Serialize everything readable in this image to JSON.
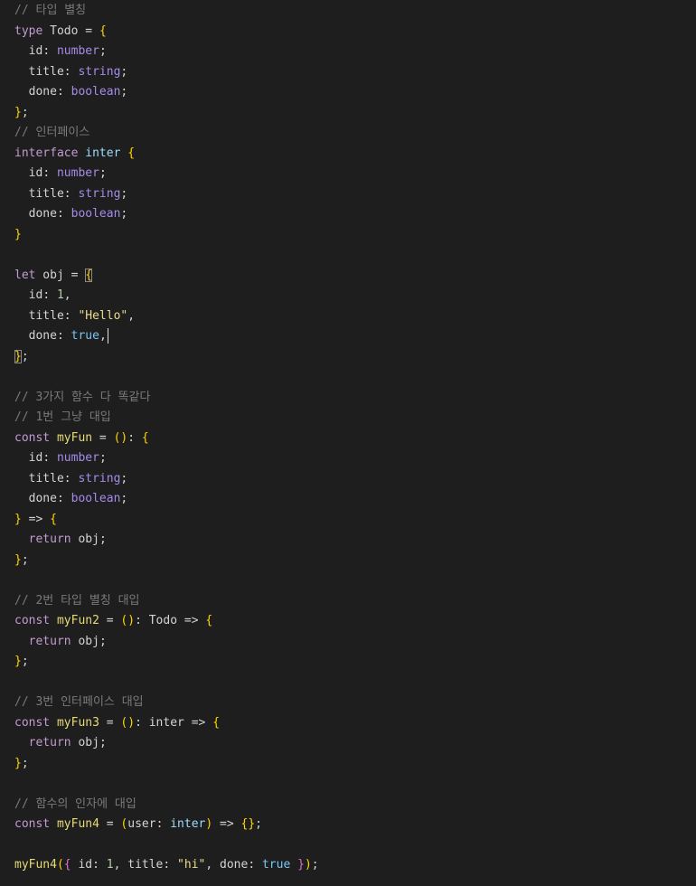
{
  "colors": {
    "background": "#1e1e1e",
    "comment": "#7a7a7a",
    "keyword": "#c39bd3",
    "brace": "#ffd700",
    "brace_nested": "#da70d6",
    "number": "#b5cea8",
    "string": "#ecdc8c",
    "bool": "#7ac6f5",
    "function_name": "#e6db74",
    "type_keyword": "#a58bea"
  },
  "lines": [
    [
      {
        "t": "comment",
        "v": "// 타입 별칭"
      }
    ],
    [
      {
        "t": "keyword",
        "v": "type"
      },
      {
        "t": "var",
        "v": " Todo "
      },
      {
        "t": "op",
        "v": "= "
      },
      {
        "t": "brace",
        "v": "{"
      }
    ],
    [
      {
        "t": "prop",
        "v": "  id"
      },
      {
        "t": "punct",
        "v": ": "
      },
      {
        "t": "typeword",
        "v": "number"
      },
      {
        "t": "punct",
        "v": ";"
      }
    ],
    [
      {
        "t": "prop",
        "v": "  title"
      },
      {
        "t": "punct",
        "v": ": "
      },
      {
        "t": "typeword",
        "v": "string"
      },
      {
        "t": "punct",
        "v": ";"
      }
    ],
    [
      {
        "t": "prop",
        "v": "  done"
      },
      {
        "t": "punct",
        "v": ": "
      },
      {
        "t": "typeword",
        "v": "boolean"
      },
      {
        "t": "punct",
        "v": ";"
      }
    ],
    [
      {
        "t": "brace",
        "v": "}"
      },
      {
        "t": "punct",
        "v": ";"
      }
    ],
    [
      {
        "t": "comment",
        "v": "// 인터페이스"
      }
    ],
    [
      {
        "t": "keyword",
        "v": "interface"
      },
      {
        "t": "var",
        "v": " "
      },
      {
        "t": "interface-name",
        "v": "inter"
      },
      {
        "t": "var",
        "v": " "
      },
      {
        "t": "brace",
        "v": "{"
      }
    ],
    [
      {
        "t": "prop",
        "v": "  id"
      },
      {
        "t": "punct",
        "v": ": "
      },
      {
        "t": "typeword",
        "v": "number"
      },
      {
        "t": "punct",
        "v": ";"
      }
    ],
    [
      {
        "t": "prop",
        "v": "  title"
      },
      {
        "t": "punct",
        "v": ": "
      },
      {
        "t": "typeword",
        "v": "string"
      },
      {
        "t": "punct",
        "v": ";"
      }
    ],
    [
      {
        "t": "prop",
        "v": "  done"
      },
      {
        "t": "punct",
        "v": ": "
      },
      {
        "t": "typeword",
        "v": "boolean"
      },
      {
        "t": "punct",
        "v": ";"
      }
    ],
    [
      {
        "t": "brace",
        "v": "}"
      }
    ],
    [],
    [
      {
        "t": "keyword",
        "v": "let"
      },
      {
        "t": "var",
        "v": " obj "
      },
      {
        "t": "op",
        "v": "= "
      },
      {
        "t": "brace",
        "v": "{",
        "match": true
      }
    ],
    [
      {
        "t": "prop",
        "v": "  id"
      },
      {
        "t": "punct",
        "v": ": "
      },
      {
        "t": "number",
        "v": "1"
      },
      {
        "t": "punct",
        "v": ","
      }
    ],
    [
      {
        "t": "prop",
        "v": "  title"
      },
      {
        "t": "punct",
        "v": ": "
      },
      {
        "t": "string",
        "v": "\"Hello\""
      },
      {
        "t": "punct",
        "v": ","
      }
    ],
    [
      {
        "t": "prop",
        "v": "  done"
      },
      {
        "t": "punct",
        "v": ": "
      },
      {
        "t": "bool",
        "v": "true"
      },
      {
        "t": "punct",
        "v": ","
      },
      {
        "t": "cursor",
        "v": ""
      }
    ],
    [
      {
        "t": "brace",
        "v": "}",
        "match": true
      },
      {
        "t": "punct",
        "v": ";"
      }
    ],
    [],
    [
      {
        "t": "comment",
        "v": "// 3가지 함수 다 똑같다"
      }
    ],
    [
      {
        "t": "comment",
        "v": "// 1번 그냥 대입"
      }
    ],
    [
      {
        "t": "keyword",
        "v": "const"
      },
      {
        "t": "var",
        "v": " "
      },
      {
        "t": "fn",
        "v": "myFun"
      },
      {
        "t": "op",
        "v": " = "
      },
      {
        "t": "brace",
        "v": "()"
      },
      {
        "t": "punct",
        "v": ": "
      },
      {
        "t": "brace",
        "v": "{"
      }
    ],
    [
      {
        "t": "prop",
        "v": "  id"
      },
      {
        "t": "punct",
        "v": ": "
      },
      {
        "t": "typeword",
        "v": "number"
      },
      {
        "t": "punct",
        "v": ";"
      }
    ],
    [
      {
        "t": "prop",
        "v": "  title"
      },
      {
        "t": "punct",
        "v": ": "
      },
      {
        "t": "typeword",
        "v": "string"
      },
      {
        "t": "punct",
        "v": ";"
      }
    ],
    [
      {
        "t": "prop",
        "v": "  done"
      },
      {
        "t": "punct",
        "v": ": "
      },
      {
        "t": "typeword",
        "v": "boolean"
      },
      {
        "t": "punct",
        "v": ";"
      }
    ],
    [
      {
        "t": "brace",
        "v": "}"
      },
      {
        "t": "op",
        "v": " => "
      },
      {
        "t": "brace",
        "v": "{"
      }
    ],
    [
      {
        "t": "keyword",
        "v": "  return"
      },
      {
        "t": "var",
        "v": " obj"
      },
      {
        "t": "punct",
        "v": ";"
      }
    ],
    [
      {
        "t": "brace",
        "v": "}"
      },
      {
        "t": "punct",
        "v": ";"
      }
    ],
    [],
    [
      {
        "t": "comment",
        "v": "// 2번 타입 별칭 대입"
      }
    ],
    [
      {
        "t": "keyword",
        "v": "const"
      },
      {
        "t": "var",
        "v": " "
      },
      {
        "t": "fn",
        "v": "myFun2"
      },
      {
        "t": "op",
        "v": " = "
      },
      {
        "t": "brace",
        "v": "()"
      },
      {
        "t": "punct",
        "v": ": "
      },
      {
        "t": "var",
        "v": "Todo"
      },
      {
        "t": "op",
        "v": " => "
      },
      {
        "t": "brace",
        "v": "{"
      }
    ],
    [
      {
        "t": "keyword",
        "v": "  return"
      },
      {
        "t": "var",
        "v": " obj"
      },
      {
        "t": "punct",
        "v": ";"
      }
    ],
    [
      {
        "t": "brace",
        "v": "}"
      },
      {
        "t": "punct",
        "v": ";"
      }
    ],
    [],
    [
      {
        "t": "comment",
        "v": "// 3번 인터페이스 대입"
      }
    ],
    [
      {
        "t": "keyword",
        "v": "const"
      },
      {
        "t": "var",
        "v": " "
      },
      {
        "t": "fn",
        "v": "myFun3"
      },
      {
        "t": "op",
        "v": " = "
      },
      {
        "t": "brace",
        "v": "()"
      },
      {
        "t": "punct",
        "v": ": "
      },
      {
        "t": "var",
        "v": "inter"
      },
      {
        "t": "op",
        "v": " => "
      },
      {
        "t": "brace",
        "v": "{"
      }
    ],
    [
      {
        "t": "keyword",
        "v": "  return"
      },
      {
        "t": "var",
        "v": " obj"
      },
      {
        "t": "punct",
        "v": ";"
      }
    ],
    [
      {
        "t": "brace",
        "v": "}"
      },
      {
        "t": "punct",
        "v": ";"
      }
    ],
    [],
    [
      {
        "t": "comment",
        "v": "// 함수의 인자에 대입"
      }
    ],
    [
      {
        "t": "keyword",
        "v": "const"
      },
      {
        "t": "var",
        "v": " "
      },
      {
        "t": "fn",
        "v": "myFun4"
      },
      {
        "t": "op",
        "v": " = "
      },
      {
        "t": "brace",
        "v": "("
      },
      {
        "t": "param",
        "v": "user"
      },
      {
        "t": "punct",
        "v": ": "
      },
      {
        "t": "interface-name",
        "v": "inter"
      },
      {
        "t": "brace",
        "v": ")"
      },
      {
        "t": "op",
        "v": " => "
      },
      {
        "t": "brace",
        "v": "{}"
      },
      {
        "t": "punct",
        "v": ";"
      }
    ],
    [],
    [
      {
        "t": "fn",
        "v": "myFun4"
      },
      {
        "t": "brace",
        "v": "("
      },
      {
        "t": "brace2",
        "v": "{"
      },
      {
        "t": "prop",
        "v": " id"
      },
      {
        "t": "punct",
        "v": ": "
      },
      {
        "t": "number",
        "v": "1"
      },
      {
        "t": "punct",
        "v": ", "
      },
      {
        "t": "prop",
        "v": "title"
      },
      {
        "t": "punct",
        "v": ": "
      },
      {
        "t": "string",
        "v": "\"hi\""
      },
      {
        "t": "punct",
        "v": ", "
      },
      {
        "t": "prop",
        "v": "done"
      },
      {
        "t": "punct",
        "v": ": "
      },
      {
        "t": "bool",
        "v": "true"
      },
      {
        "t": "punct",
        "v": " "
      },
      {
        "t": "brace2",
        "v": "}"
      },
      {
        "t": "brace",
        "v": ")"
      },
      {
        "t": "punct",
        "v": ";"
      }
    ]
  ]
}
